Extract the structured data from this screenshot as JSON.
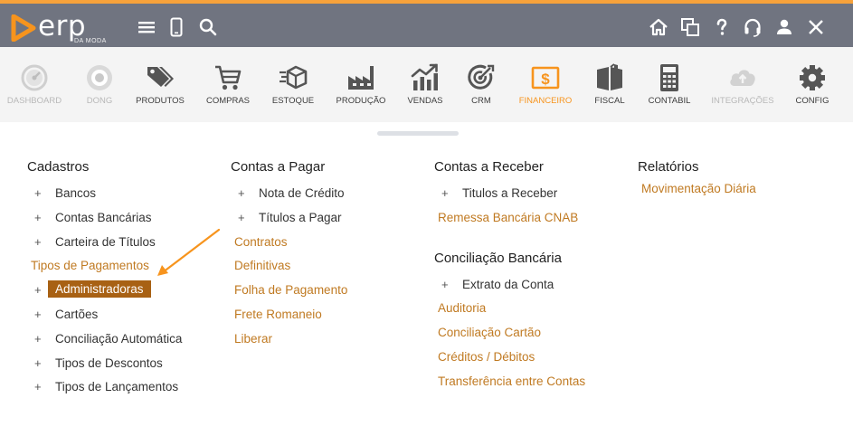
{
  "app": {
    "logo_text": "erp",
    "logo_subtext": "DA MODA"
  },
  "colors": {
    "accent": "#f7a23b",
    "topbar": "#707480",
    "link": "#c07a22",
    "highlight": "#a86114",
    "active_module": "#f7941d"
  },
  "topbar_icons": [
    "menu-icon",
    "mobile-icon",
    "search-icon",
    "home-icon",
    "windows-icon",
    "help-icon",
    "headset-icon",
    "user-icon",
    "close-icon"
  ],
  "modules": [
    {
      "label": "DASHBOARD",
      "icon": "gauge-icon",
      "state": "disabled"
    },
    {
      "label": "DONG",
      "icon": "dong-icon",
      "state": "disabled"
    },
    {
      "label": "PRODUTOS",
      "icon": "tags-icon",
      "state": "normal"
    },
    {
      "label": "COMPRAS",
      "icon": "cart-icon",
      "state": "normal"
    },
    {
      "label": "ESTOQUE",
      "icon": "box-icon",
      "state": "normal"
    },
    {
      "label": "PRODUÇÃO",
      "icon": "factory-icon",
      "state": "normal"
    },
    {
      "label": "VENDAS",
      "icon": "chart-up-icon",
      "state": "normal"
    },
    {
      "label": "CRM",
      "icon": "target-icon",
      "state": "normal"
    },
    {
      "label": "FINANCEIRO",
      "icon": "dollar-icon",
      "state": "active"
    },
    {
      "label": "FISCAL",
      "icon": "book-icon",
      "state": "normal"
    },
    {
      "label": "CONTABIL",
      "icon": "calculator-icon",
      "state": "normal"
    },
    {
      "label": "INTEGRAÇÕES",
      "icon": "cloud-upload-icon",
      "state": "disabled"
    },
    {
      "label": "CONFIG",
      "icon": "gear-icon",
      "state": "normal"
    }
  ],
  "menu": {
    "cadastros": {
      "title": "Cadastros",
      "items": [
        {
          "label": "Bancos",
          "type": "plus"
        },
        {
          "label": "Contas Bancárias",
          "type": "plus"
        },
        {
          "label": "Carteira de Títulos",
          "type": "plus"
        },
        {
          "label": "Tipos de Pagamentos",
          "type": "link"
        },
        {
          "label": "Administradoras",
          "type": "plus-highlight"
        },
        {
          "label": "Cartões",
          "type": "plus"
        },
        {
          "label": "Conciliação Automática",
          "type": "plus"
        },
        {
          "label": "Tipos de Descontos",
          "type": "plus"
        },
        {
          "label": "Tipos de Lançamentos",
          "type": "plus"
        }
      ]
    },
    "contas_pagar": {
      "title": "Contas a Pagar",
      "items": [
        {
          "label": "Nota de Crédito",
          "type": "plus"
        },
        {
          "label": "Títulos a Pagar",
          "type": "plus"
        },
        {
          "label": "Contratos",
          "type": "link"
        },
        {
          "label": "Definitivas",
          "type": "link"
        },
        {
          "label": "Folha de Pagamento",
          "type": "link"
        },
        {
          "label": "Frete Romaneio",
          "type": "link"
        },
        {
          "label": "Liberar",
          "type": "link"
        }
      ]
    },
    "contas_receber": {
      "title": "Contas a Receber",
      "items": [
        {
          "label": "Titulos a Receber",
          "type": "plus"
        },
        {
          "label": "Remessa Bancária CNAB",
          "type": "link"
        }
      ]
    },
    "conciliacao": {
      "title": "Conciliação Bancária",
      "items": [
        {
          "label": "Extrato da Conta",
          "type": "plus"
        },
        {
          "label": "Auditoria",
          "type": "link"
        },
        {
          "label": "Conciliação Cartão",
          "type": "link"
        },
        {
          "label": "Créditos / Débitos",
          "type": "link"
        },
        {
          "label": "Transferência entre Contas",
          "type": "link"
        }
      ]
    },
    "relatorios": {
      "title": "Relatórios",
      "items": [
        {
          "label": "Movimentação Diária",
          "type": "link"
        }
      ]
    }
  }
}
